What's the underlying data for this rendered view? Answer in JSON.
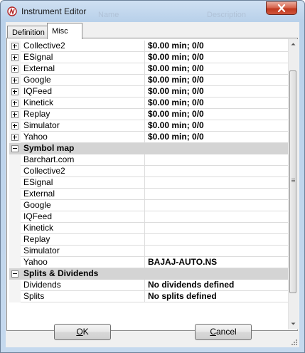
{
  "window": {
    "title": "Instrument Editor",
    "ghost_headers": [
      "Name",
      "Description"
    ]
  },
  "tabs": [
    {
      "label": "Definition"
    },
    {
      "label": "Misc"
    }
  ],
  "grid": {
    "rows": [
      {
        "type": "item",
        "expandable": true,
        "name": "Collective2",
        "value": "$0.00 min;  0/0"
      },
      {
        "type": "item",
        "expandable": true,
        "name": "ESignal",
        "value": "$0.00 min;  0/0"
      },
      {
        "type": "item",
        "expandable": true,
        "name": "External",
        "value": "$0.00 min;  0/0"
      },
      {
        "type": "item",
        "expandable": true,
        "name": "Google",
        "value": "$0.00 min;  0/0"
      },
      {
        "type": "item",
        "expandable": true,
        "name": "IQFeed",
        "value": "$0.00 min;  0/0"
      },
      {
        "type": "item",
        "expandable": true,
        "name": "Kinetick",
        "value": "$0.00 min;  0/0"
      },
      {
        "type": "item",
        "expandable": true,
        "name": "Replay",
        "value": "$0.00 min;  0/0"
      },
      {
        "type": "item",
        "expandable": true,
        "name": "Simulator",
        "value": "$0.00 min;  0/0"
      },
      {
        "type": "item",
        "expandable": true,
        "name": "Yahoo",
        "value": "$0.00 min;  0/0"
      },
      {
        "type": "category",
        "name": "Symbol map"
      },
      {
        "type": "item",
        "expandable": false,
        "name": "Barchart.com",
        "value": ""
      },
      {
        "type": "item",
        "expandable": false,
        "name": "Collective2",
        "value": ""
      },
      {
        "type": "item",
        "expandable": false,
        "name": "ESignal",
        "value": ""
      },
      {
        "type": "item",
        "expandable": false,
        "name": "External",
        "value": ""
      },
      {
        "type": "item",
        "expandable": false,
        "name": "Google",
        "value": ""
      },
      {
        "type": "item",
        "expandable": false,
        "name": "IQFeed",
        "value": ""
      },
      {
        "type": "item",
        "expandable": false,
        "name": "Kinetick",
        "value": ""
      },
      {
        "type": "item",
        "expandable": false,
        "name": "Replay",
        "value": ""
      },
      {
        "type": "item",
        "expandable": false,
        "name": "Simulator",
        "value": ""
      },
      {
        "type": "item",
        "expandable": false,
        "name": "Yahoo",
        "value": "BAJAJ-AUTO.NS"
      },
      {
        "type": "category",
        "name": "Splits & Dividends"
      },
      {
        "type": "item",
        "expandable": false,
        "name": "Dividends",
        "value": "No dividends defined"
      },
      {
        "type": "item",
        "expandable": false,
        "name": "Splits",
        "value": "No splits defined"
      }
    ]
  },
  "buttons": {
    "ok": "OK",
    "cancel": "Cancel"
  },
  "icons": {
    "app": "ninja-logo-icon",
    "close": "close-icon",
    "scroll_up": "arrow-up-icon",
    "scroll_down": "arrow-down-icon"
  },
  "colors": {
    "titlebar": "#b9d1ea",
    "close": "#c0391f",
    "category_row": "#d4d4d4"
  }
}
